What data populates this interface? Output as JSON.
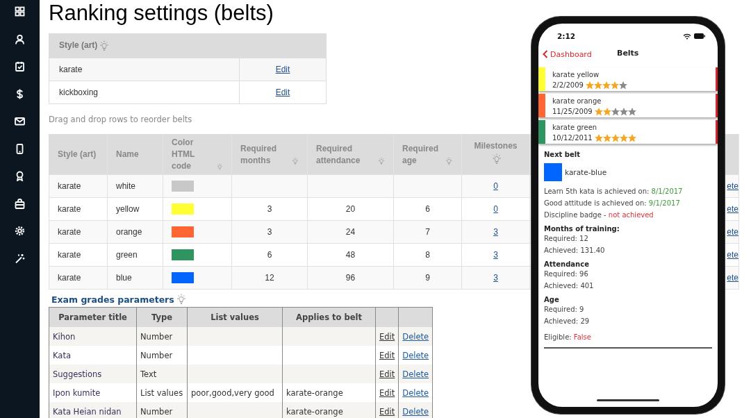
{
  "page": {
    "title": "Ranking settings (belts)"
  },
  "styles_table": {
    "columns": [
      {
        "label": "Style (art)",
        "help": true
      }
    ],
    "rows": [
      {
        "style": "karate",
        "action": "Edit"
      },
      {
        "style": "kickboxing",
        "action": "Edit"
      }
    ]
  },
  "hint": "Drag and drop rows to reorder belts",
  "belts_table": {
    "columns": [
      {
        "label": "Style (art)",
        "help": false
      },
      {
        "label": "Name",
        "help": false
      },
      {
        "label": "Color HTML code",
        "help": true
      },
      {
        "label": "Required months",
        "help": true
      },
      {
        "label": "Required attendance",
        "help": true
      },
      {
        "label": "Required age",
        "help": true
      },
      {
        "label": "Milestones",
        "help": true
      }
    ],
    "rows": [
      {
        "style": "karate",
        "name": "white",
        "color": "#c8c8c8",
        "milestones": "0",
        "column_9": "ete"
      },
      {
        "style": "karate",
        "name": "yellow",
        "color": "#ffff33",
        "months": "3",
        "attendance": "20",
        "age": "6",
        "milestones": "0",
        "column_9": "ete"
      },
      {
        "style": "karate",
        "name": "orange",
        "color": "#ff6633",
        "months": "3",
        "attendance": "24",
        "age": "7",
        "milestones": "3",
        "column_9": "ete"
      },
      {
        "style": "karate",
        "name": "green",
        "color": "#2e9460",
        "months": "6",
        "attendance": "48",
        "age": "8",
        "milestones": "3",
        "column_9": "ete"
      },
      {
        "style": "karate",
        "name": "blue",
        "color": "#0066ff",
        "months": "12",
        "attendance": "96",
        "age": "9",
        "milestones": "3",
        "column_9": "ete"
      }
    ]
  },
  "exam": {
    "title": "Exam grades parameters",
    "help": true,
    "columns": [
      "Parameter title",
      "Type",
      "List values",
      "Applies to belt"
    ],
    "rows": [
      {
        "title": "Kihon",
        "type": "Number",
        "edit": "Edit",
        "delete": "Delete"
      },
      {
        "title": "Kata",
        "type": "Number",
        "edit": "Edit",
        "delete": "Delete"
      },
      {
        "title": "Suggestions",
        "type": "Text",
        "edit": "Edit",
        "delete": "Delete"
      },
      {
        "title": "Ipon kumite",
        "type": "List values",
        "list_values": "poor,good,very good",
        "applies_to": "karate-orange",
        "edit": "Edit",
        "delete": "Delete"
      },
      {
        "title": "Kata Heian nidan",
        "type": "Number",
        "applies_to": "karate-orange",
        "edit": "Edit",
        "delete": "Delete"
      }
    ]
  },
  "phone": {
    "time": "2:12",
    "back": "Dashboard",
    "title": "Belts",
    "belts": [
      {
        "name": "karate yellow",
        "date": "2/2/2009",
        "stars": 4,
        "color": "#ffff33"
      },
      {
        "name": "karate orange",
        "date": "11/25/2009",
        "stars": 2,
        "color": "#ff6633"
      },
      {
        "name": "karate green",
        "date": "10/12/2011",
        "stars": 5,
        "color": "#2e9460"
      }
    ],
    "next_belt": {
      "heading": "Next belt",
      "name": "karate-blue",
      "color": "#0066ff"
    },
    "milestones": [
      {
        "label": "Learn 5th kata is achieved on:",
        "value": "8/1/2017",
        "achieved": true
      },
      {
        "label": "Good attitude is achieved on:",
        "value": "9/1/2017",
        "achieved": true
      },
      {
        "label": "Discipline badge -",
        "value": "not achieved",
        "achieved": false
      }
    ],
    "sections": [
      {
        "heading": "Months of training:",
        "lines": [
          "Required: 12",
          "Achieved: 131.40"
        ]
      },
      {
        "heading": "Attendance",
        "lines": [
          "Required: 96",
          "Achieved: 401"
        ]
      },
      {
        "heading": "Age",
        "lines": [
          "Required: 9",
          "Achieved: 29"
        ]
      }
    ],
    "eligible": {
      "label": "Eligible:",
      "value": "False",
      "eligible": false
    }
  }
}
